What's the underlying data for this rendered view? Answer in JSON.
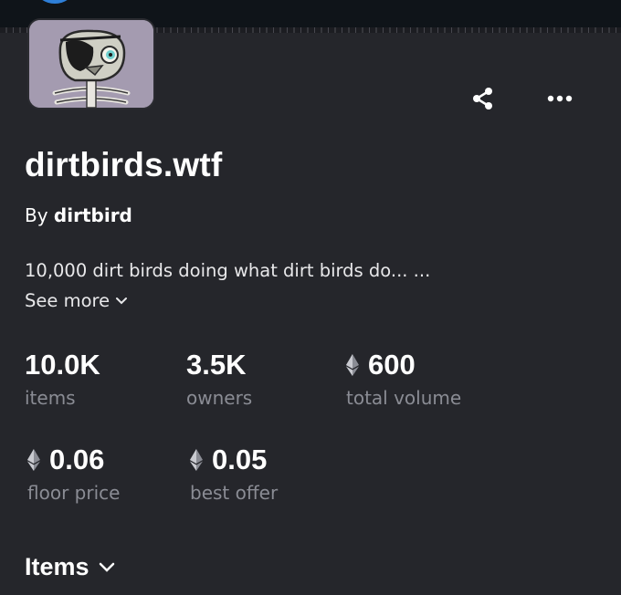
{
  "collection": {
    "name": "dirtbirds.wtf",
    "by_prefix": "By",
    "creator": "dirtbird",
    "description": "10,000 dirt birds doing what dirt birds do... ...",
    "see_more_label": "See more"
  },
  "stats": [
    {
      "value": "10.0K",
      "label": "items"
    },
    {
      "value": "3.5K",
      "label": "owners"
    },
    {
      "value": "600",
      "label": "total volume"
    },
    {
      "value": "0.06",
      "label": "floor price"
    },
    {
      "value": "0.05",
      "label": "best offer"
    }
  ],
  "sections": {
    "items_label": "Items"
  },
  "icons": {
    "share": "share-icon",
    "more": "more-horizontal-icon",
    "eth": "ethereum-icon",
    "chevron": "chevron-down-icon"
  },
  "colors": {
    "background": "#25262b",
    "topbar": "#0f1419",
    "muted_text": "#8a8c94",
    "accent_blue": "#2e7fd8"
  }
}
